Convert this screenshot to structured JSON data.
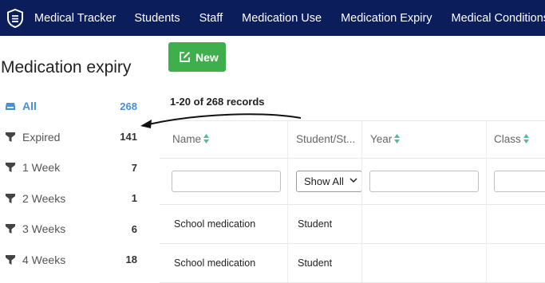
{
  "header": {
    "brand": "Medical Tracker",
    "nav": [
      "Students",
      "Staff",
      "Medication Use",
      "Medication Expiry",
      "Medical Conditions"
    ]
  },
  "sidebar": {
    "title": "Medication expiry",
    "items": [
      {
        "label": "All",
        "count": "268",
        "icon": "inbox-icon",
        "active": true
      },
      {
        "label": "Expired",
        "count": "141",
        "icon": "filter-icon"
      },
      {
        "label": "1 Week",
        "count": "7",
        "icon": "filter-icon"
      },
      {
        "label": "2 Weeks",
        "count": "1",
        "icon": "filter-icon"
      },
      {
        "label": "3 Weeks",
        "count": "6",
        "icon": "filter-icon"
      },
      {
        "label": "4 Weeks",
        "count": "18",
        "icon": "filter-icon"
      }
    ]
  },
  "toolbar": {
    "new_label": "New"
  },
  "records_text": "1-20 of 268 records",
  "table": {
    "columns": [
      "Name",
      "Student/St...",
      "Year",
      "Class"
    ],
    "filter_select": "Show All",
    "rows": [
      {
        "name": "School medication",
        "type": "Student"
      },
      {
        "name": "School medication",
        "type": "Student"
      }
    ]
  },
  "colors": {
    "topbar": "#0c1d5c",
    "new_button": "#3fae4d",
    "active": "#4a90d6",
    "sort_icon": "#5cb89a"
  }
}
